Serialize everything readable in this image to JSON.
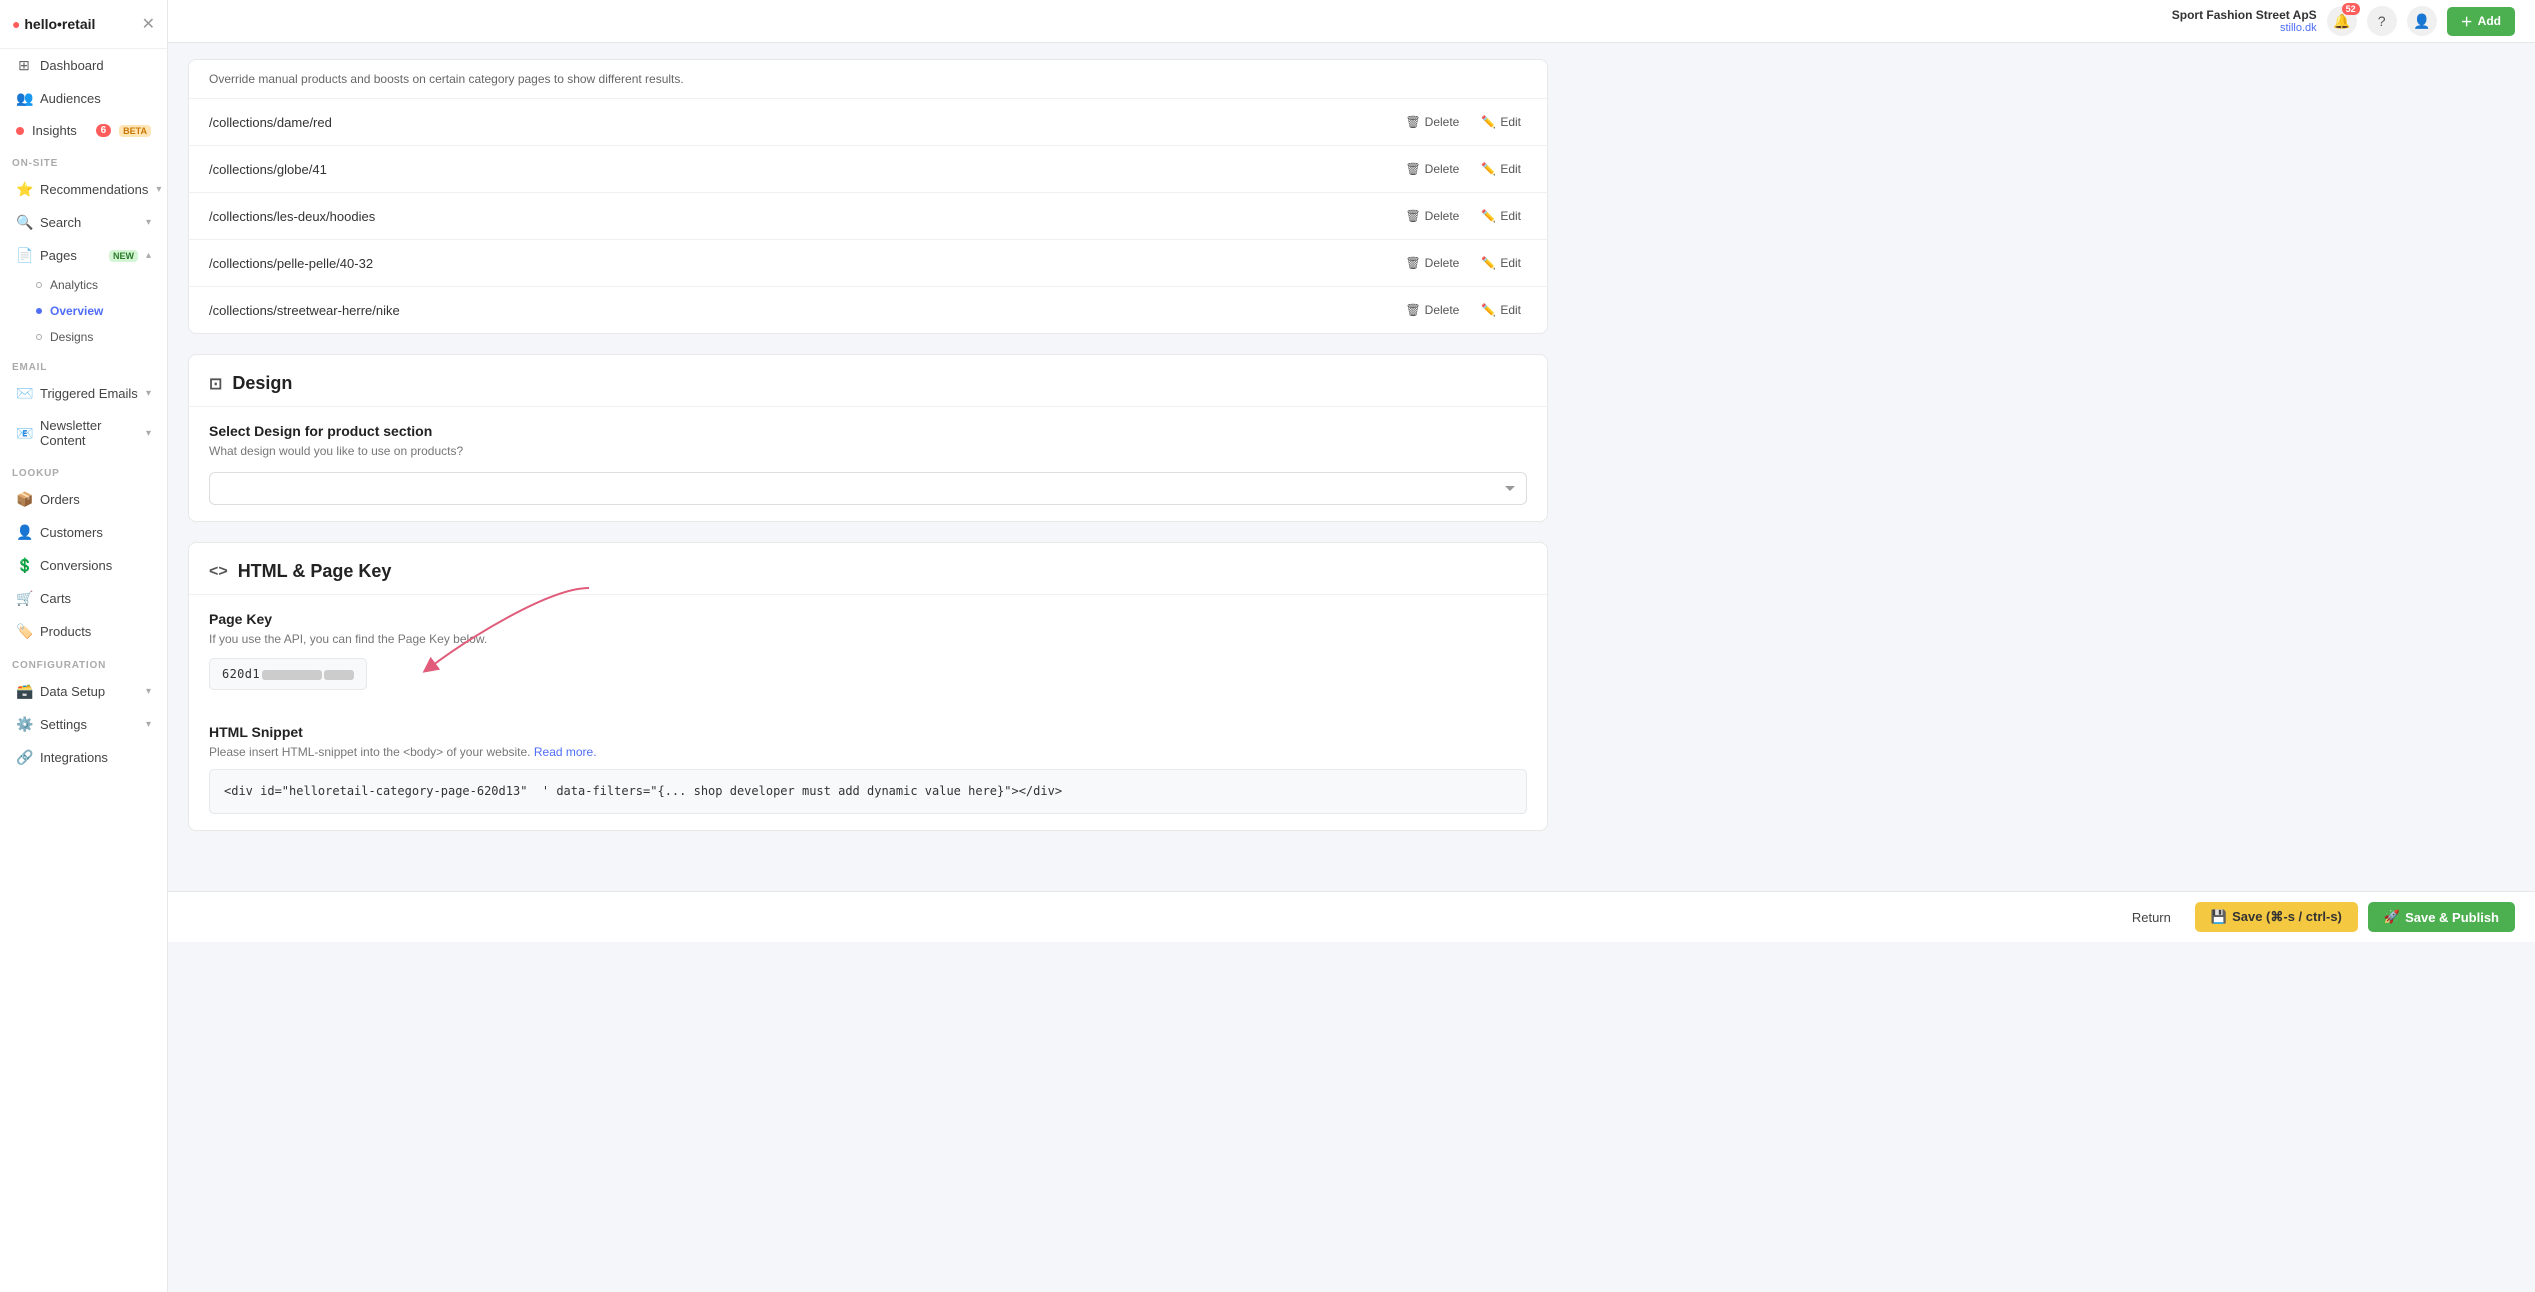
{
  "app": {
    "logo": "hello•retail",
    "store_name": "Sport Fashion Street ApS",
    "store_url": "stillo.dk",
    "notif_count": "52"
  },
  "sidebar": {
    "main_items": [
      {
        "id": "dashboard",
        "icon": "⊞",
        "label": "Dashboard",
        "active": false
      },
      {
        "id": "audiences",
        "icon": "👥",
        "label": "Audiences",
        "active": false
      }
    ],
    "insights": {
      "label": "Insights",
      "icon": "📊",
      "badge": "6",
      "badge_type": "number",
      "beta": true
    },
    "onsite_label": "ON-SITE",
    "onsite_items": [
      {
        "id": "recommendations",
        "icon": "⭐",
        "label": "Recommendations",
        "has_chevron": true
      },
      {
        "id": "search",
        "icon": "🔍",
        "label": "Search",
        "has_chevron": true
      },
      {
        "id": "pages",
        "icon": "📄",
        "label": "Pages",
        "badge_new": true,
        "has_chevron": true,
        "expanded": true
      }
    ],
    "pages_sub": [
      {
        "id": "analytics",
        "label": "Analytics",
        "active": false
      },
      {
        "id": "overview",
        "label": "Overview",
        "active": true
      },
      {
        "id": "designs",
        "label": "Designs",
        "active": false
      }
    ],
    "email_label": "EMAIL",
    "email_items": [
      {
        "id": "triggered-emails",
        "icon": "✉️",
        "label": "Triggered Emails",
        "has_chevron": true
      },
      {
        "id": "newsletter",
        "icon": "📧",
        "label": "Newsletter Content",
        "has_chevron": true
      }
    ],
    "lookup_label": "LOOKUP",
    "lookup_items": [
      {
        "id": "orders",
        "icon": "📦",
        "label": "Orders"
      },
      {
        "id": "customers",
        "icon": "👤",
        "label": "Customers"
      },
      {
        "id": "conversions",
        "icon": "💲",
        "label": "Conversions"
      },
      {
        "id": "carts",
        "icon": "🛒",
        "label": "Carts"
      },
      {
        "id": "products",
        "icon": "🏷️",
        "label": "Products"
      }
    ],
    "config_label": "CONFIGURATION",
    "config_items": [
      {
        "id": "data-setup",
        "icon": "🗃️",
        "label": "Data Setup",
        "has_chevron": true
      },
      {
        "id": "settings",
        "icon": "⚙️",
        "label": "Settings",
        "has_chevron": true
      },
      {
        "id": "integrations",
        "icon": "🔗",
        "label": "Integrations"
      }
    ]
  },
  "topbar": {
    "add_label": "Add"
  },
  "override_section": {
    "description": "Override manual products and boosts on certain category pages to show different results.",
    "collections": [
      {
        "path": "/collections/dame/red"
      },
      {
        "path": "/collections/globe/41"
      },
      {
        "path": "/collections/les-deux/hoodies"
      },
      {
        "path": "/collections/pelle-pelle/40-32"
      },
      {
        "path": "/collections/streetwear-herre/nike"
      }
    ],
    "delete_label": "Delete",
    "edit_label": "Edit"
  },
  "design_section": {
    "title": "Design",
    "subtitle": "Select Design for product section",
    "desc": "What design would you like to use on products?",
    "select_placeholder": ""
  },
  "html_section": {
    "title": "HTML & Page Key",
    "page_key_label": "Page Key",
    "page_key_desc": "If you use the API, you can find the Page Key below.",
    "page_key_prefix": "620d1",
    "html_snippet_label": "HTML Snippet",
    "html_snippet_desc": "Please insert HTML-snippet into the <body> of your website.",
    "read_more_label": "Read more.",
    "html_code": "<div id=\"helloretail-category-page-620d13\"  ' data-filters=\"{... shop developer must add dynamic value here}\"></div>"
  },
  "bottombar": {
    "return_label": "Return",
    "save_label": "Save (⌘-s / ctrl-s)",
    "save_publish_label": "Save & Publish"
  }
}
